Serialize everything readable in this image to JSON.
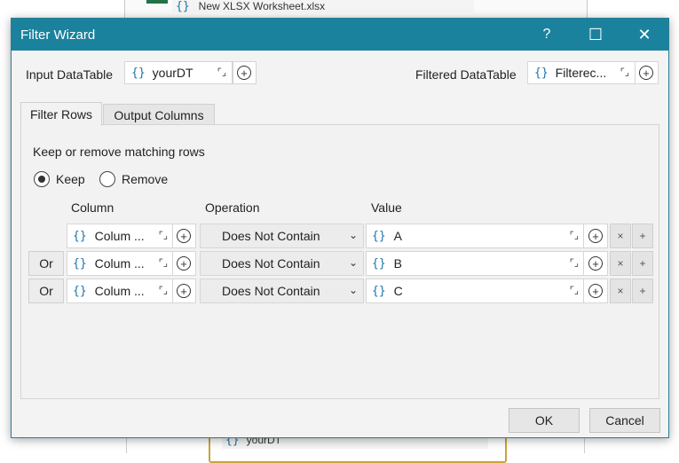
{
  "background": {
    "top_file": "New XLSX Worksheet.xlsx",
    "bottom_var": "yourDT"
  },
  "dialog": {
    "title": "Filter Wizard",
    "help_glyph": "?",
    "maximize_glyph": "☐",
    "close_glyph": "✕"
  },
  "input_datatable": {
    "label": "Input DataTable",
    "value": "yourDT"
  },
  "filtered_datatable": {
    "label": "Filtered DataTable",
    "value": "Filterec..."
  },
  "tabs": [
    {
      "label": "Filter Rows",
      "active": true
    },
    {
      "label": "Output Columns",
      "active": false
    }
  ],
  "filter": {
    "heading": "Keep or remove matching rows",
    "keep_label": "Keep",
    "remove_label": "Remove",
    "selected": "Keep",
    "col_header_column": "Column",
    "col_header_operation": "Operation",
    "col_header_value": "Value",
    "rows": [
      {
        "connector": "",
        "column": "Colum ...",
        "operation": "Does Not Contain",
        "value": "A"
      },
      {
        "connector": "Or",
        "column": "Colum ...",
        "operation": "Does Not Contain",
        "value": "B"
      },
      {
        "connector": "Or",
        "column": "Colum ...",
        "operation": "Does Not Contain",
        "value": "C"
      }
    ],
    "remove_row_glyph": "×",
    "add_row_glyph": "+"
  },
  "buttons": {
    "ok": "OK",
    "cancel": "Cancel"
  },
  "glyphs": {
    "brace": "{}",
    "expand": "⌜⌟",
    "plus": "+",
    "chevron": "⌄"
  },
  "colors": {
    "titlebar": "#1b829d",
    "brace": "#1a73a8",
    "frame": "#c9a43a"
  }
}
